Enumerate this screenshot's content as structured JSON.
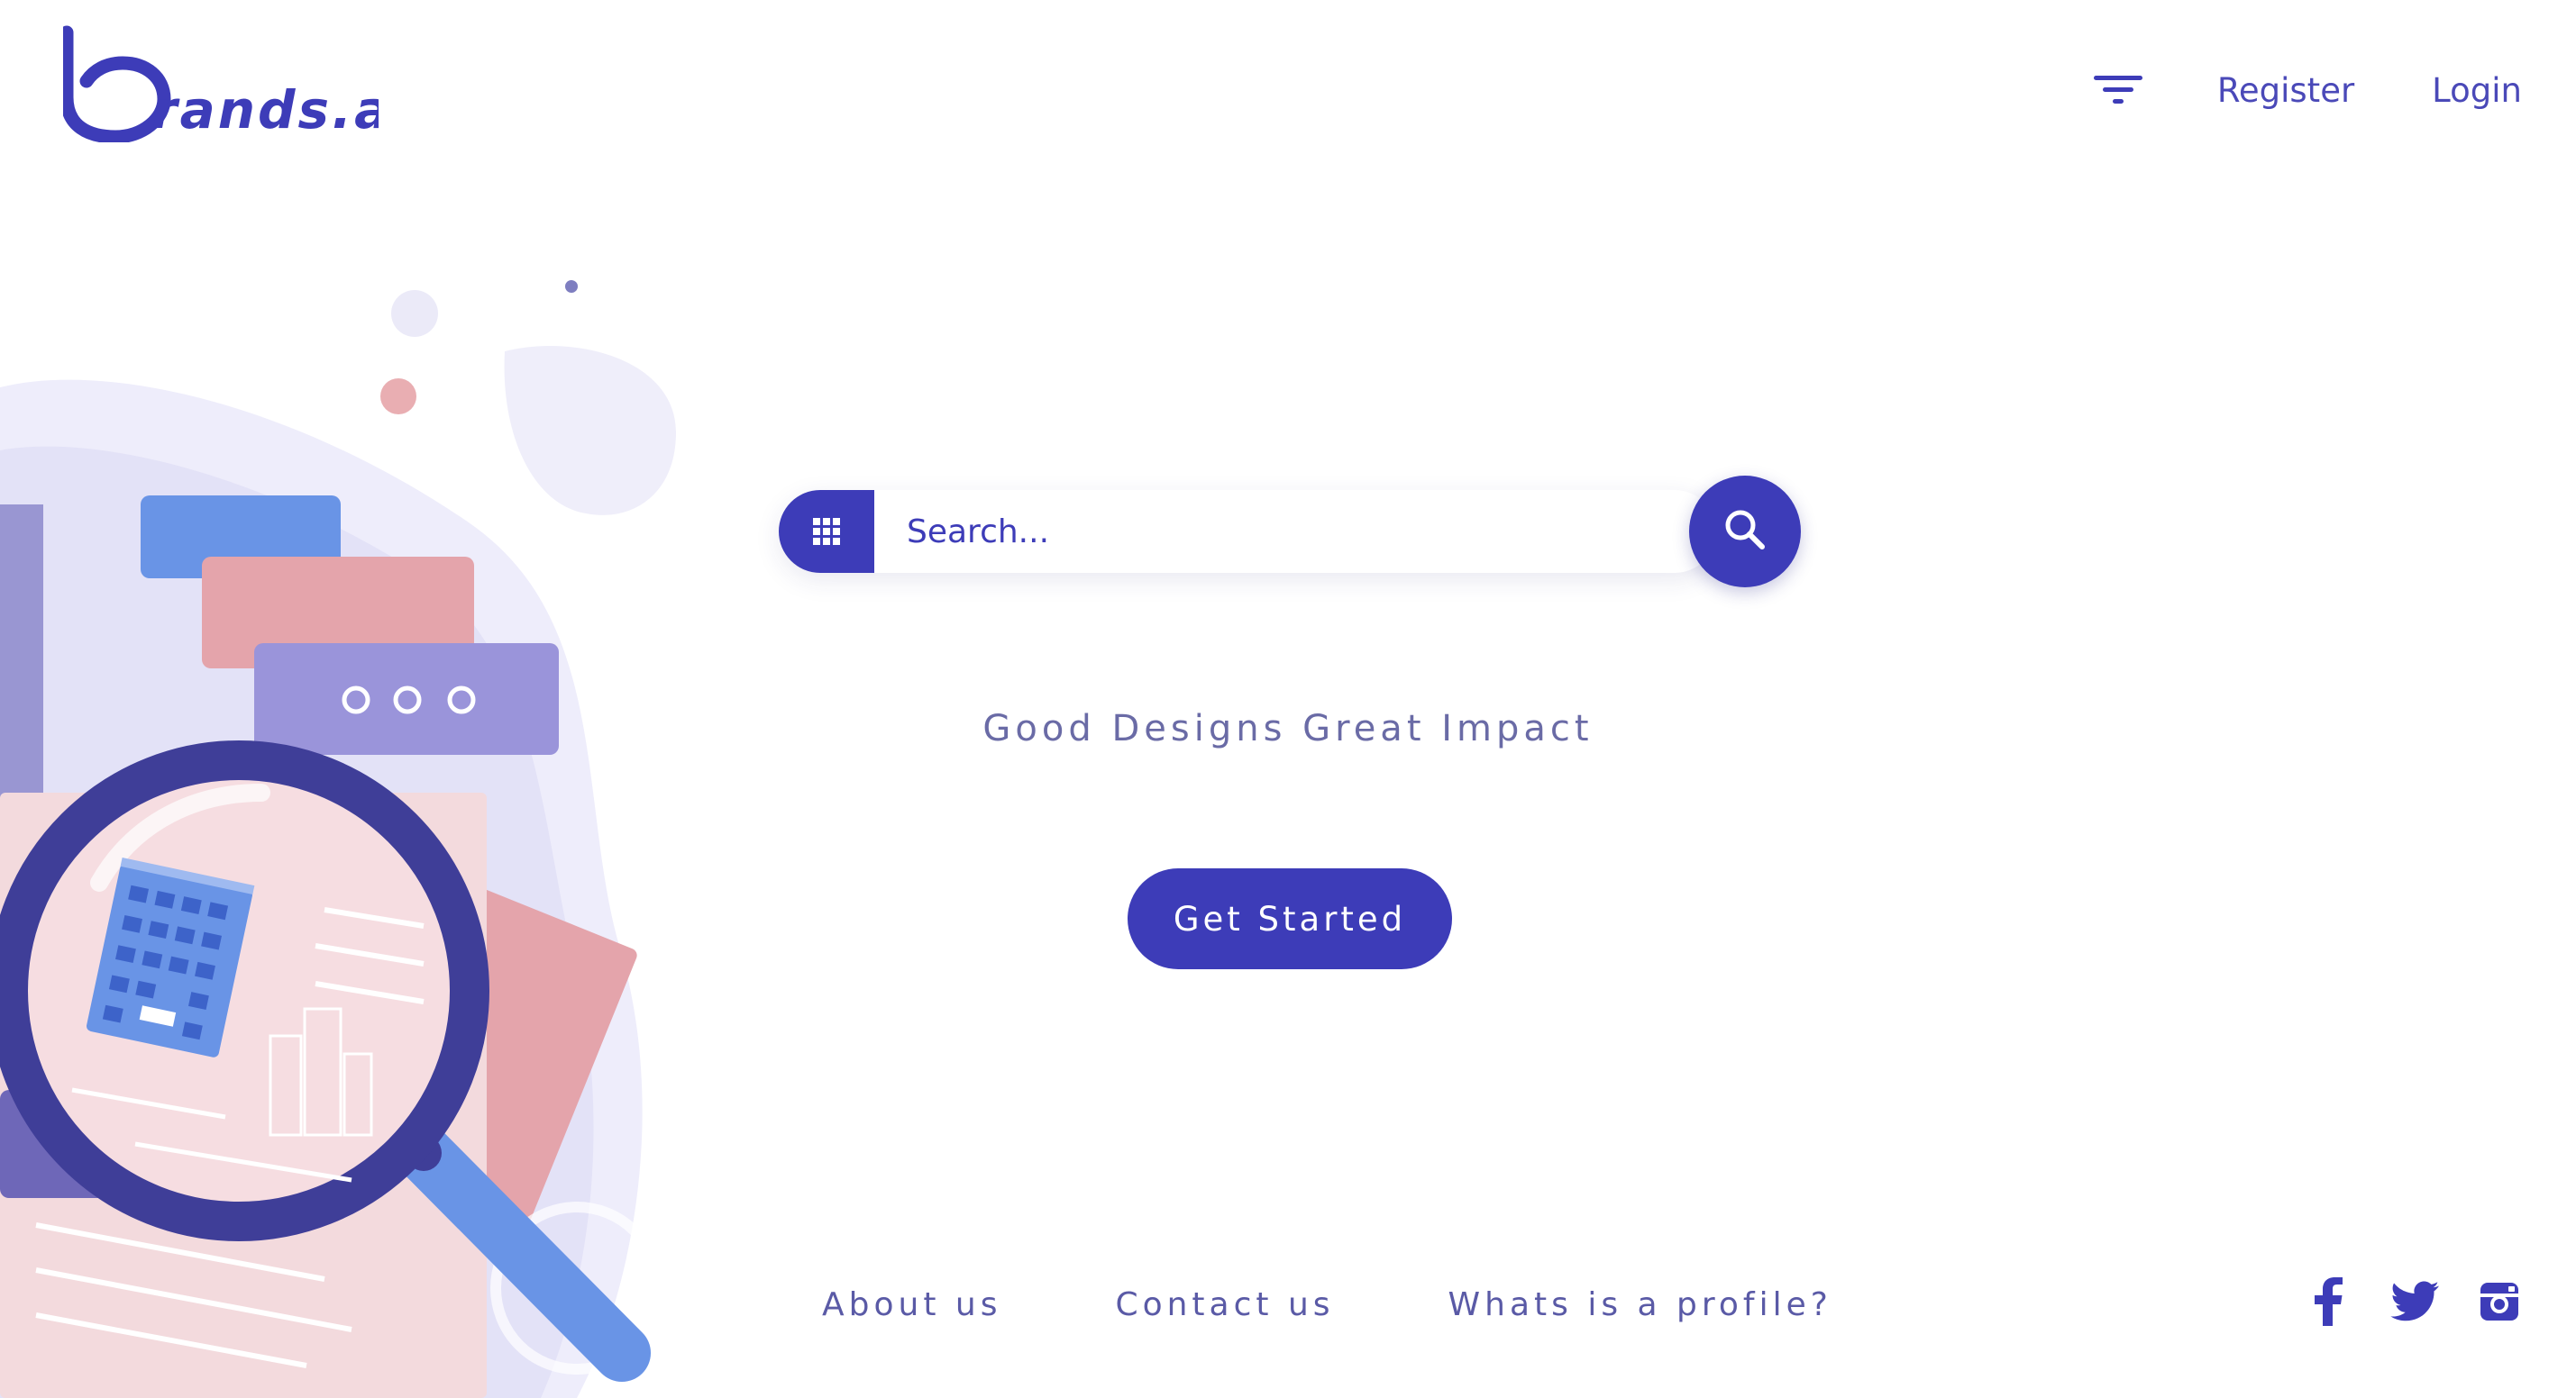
{
  "header": {
    "logo_text": "brands.af",
    "nav": {
      "filter_icon": "filter-lines-icon",
      "register_label": "Register",
      "login_label": "Login"
    }
  },
  "illustration": {
    "subject": "magnifying-glass-over-documents",
    "card_dots": "o o o"
  },
  "search": {
    "placeholder": "Search...",
    "value": "",
    "grid_icon": "grid-icon",
    "search_icon": "search-icon"
  },
  "hero": {
    "tagline": "Good Designs Great Impact",
    "cta_label": "Get Started"
  },
  "footer": {
    "links": [
      {
        "label": "About us"
      },
      {
        "label": "Contact us"
      },
      {
        "label": "Whats is a profile?"
      }
    ],
    "social": [
      {
        "name": "facebook-icon"
      },
      {
        "name": "twitter-icon"
      },
      {
        "name": "instagram-icon"
      }
    ]
  },
  "colors": {
    "brand": "#3d3cb8",
    "text_muted": "#6a6ba6",
    "background": "#ffffff",
    "accent_pink": "#e4a4ab",
    "accent_blue": "#6d95e6",
    "accent_lavender": "#9a94da"
  }
}
